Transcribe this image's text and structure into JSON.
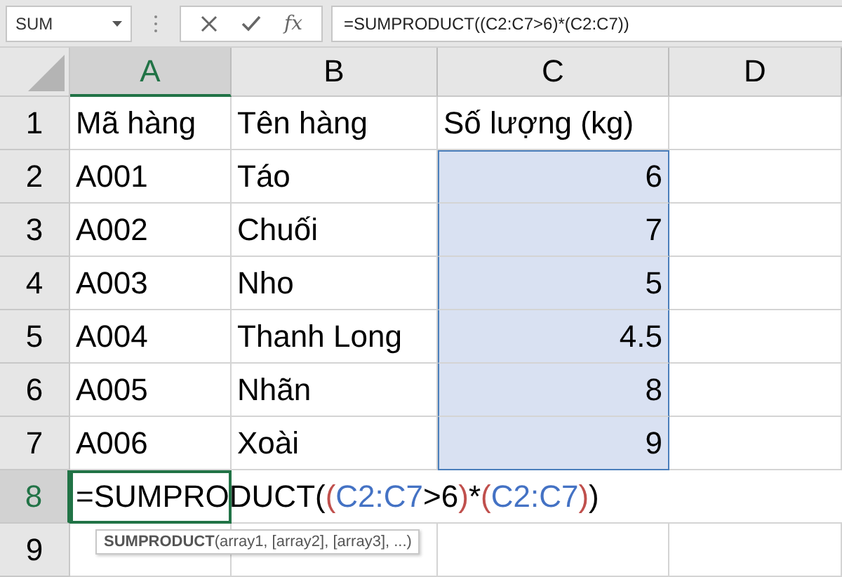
{
  "name_box": {
    "value": "SUM"
  },
  "formula_bar": {
    "buttons": [
      {
        "kind": "cancel"
      },
      {
        "kind": "enter"
      },
      {
        "kind": "function",
        "label": "fx"
      }
    ],
    "value": "=SUMPRODUCT((C2:C7>6)*(C2:C7))"
  },
  "columns": [
    {
      "label": "A",
      "selected": true
    },
    {
      "label": "B",
      "selected": false
    },
    {
      "label": "C",
      "selected": false
    },
    {
      "label": "D",
      "selected": false
    }
  ],
  "rows": [
    {
      "label": "1",
      "selected": false,
      "cells": [
        {
          "text": "Mã hàng",
          "kind": "text",
          "selected": false
        },
        {
          "text": "Tên hàng",
          "kind": "text",
          "selected": false
        },
        {
          "text": "Số lượng (kg)",
          "kind": "text",
          "selected": false
        }
      ]
    },
    {
      "label": "2",
      "selected": false,
      "cells": [
        {
          "text": "A001",
          "kind": "text",
          "selected": false
        },
        {
          "text": "Táo",
          "kind": "text",
          "selected": false
        },
        {
          "text": "6",
          "kind": "number",
          "selected": true
        }
      ]
    },
    {
      "label": "3",
      "selected": false,
      "cells": [
        {
          "text": "A002",
          "kind": "text",
          "selected": false
        },
        {
          "text": "Chuối",
          "kind": "text",
          "selected": false
        },
        {
          "text": "7",
          "kind": "number",
          "selected": true
        }
      ]
    },
    {
      "label": "4",
      "selected": false,
      "cells": [
        {
          "text": "A003",
          "kind": "text",
          "selected": false
        },
        {
          "text": "Nho",
          "kind": "text",
          "selected": false
        },
        {
          "text": "5",
          "kind": "number",
          "selected": true
        }
      ]
    },
    {
      "label": "5",
      "selected": false,
      "cells": [
        {
          "text": "A004",
          "kind": "text",
          "selected": false
        },
        {
          "text": "Thanh Long",
          "kind": "text",
          "selected": false
        },
        {
          "text": "4.5",
          "kind": "number",
          "selected": true
        }
      ]
    },
    {
      "label": "6",
      "selected": false,
      "cells": [
        {
          "text": "A005",
          "kind": "text",
          "selected": false
        },
        {
          "text": "Nhãn",
          "kind": "text",
          "selected": false
        },
        {
          "text": "8",
          "kind": "number",
          "selected": true
        }
      ]
    },
    {
      "label": "7",
      "selected": false,
      "cells": [
        {
          "text": "A006",
          "kind": "text",
          "selected": false
        },
        {
          "text": "Xoài",
          "kind": "text",
          "selected": false
        },
        {
          "text": "9",
          "kind": "number",
          "selected": true
        }
      ]
    },
    {
      "label": "8",
      "selected": true,
      "editing": {
        "tokens": [
          {
            "text": "=SUMPRODUCT(",
            "color": "#000000"
          },
          {
            "text": "(",
            "color": "#c0504d"
          },
          {
            "text": "C2:C7",
            "color": "#4472c4"
          },
          {
            "text": ">6",
            "color": "#000000"
          },
          {
            "text": ")",
            "color": "#c0504d"
          },
          {
            "text": "*",
            "color": "#000000"
          },
          {
            "text": "(",
            "color": "#c0504d"
          },
          {
            "text": "C2:C7",
            "color": "#4472c4"
          },
          {
            "text": ")",
            "color": "#c0504d"
          },
          {
            "text": ")",
            "color": "#000000"
          }
        ],
        "tooltip": "**SUMPRODUCT**(array1, [array2], [array3], ...)"
      }
    },
    {
      "label": "9",
      "selected": false
    }
  ]
}
